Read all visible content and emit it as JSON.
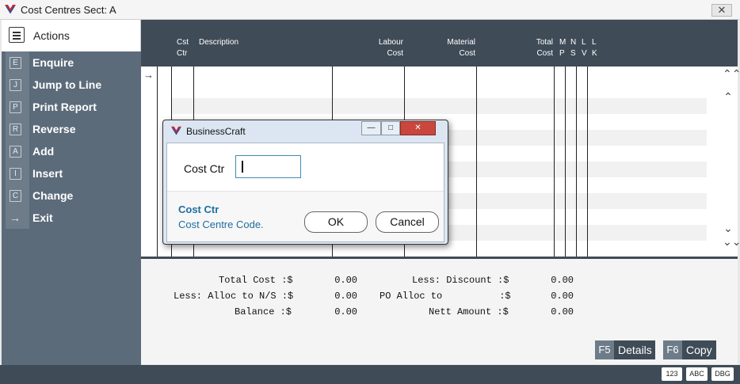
{
  "window": {
    "title": "Cost Centres  Sect: A",
    "close_label": "✕",
    "logo_icon": "businesscraft-logo-icon"
  },
  "sidebar": {
    "header_label": "Actions",
    "items": [
      {
        "key": "E",
        "label": "Enquire"
      },
      {
        "key": "J",
        "label": "Jump to Line"
      },
      {
        "key": "P",
        "label": "Print Report"
      },
      {
        "key": "R",
        "label": "Reverse"
      },
      {
        "key": "A",
        "label": "Add"
      },
      {
        "key": "I",
        "label": "Insert"
      },
      {
        "key": "C",
        "label": "Change"
      },
      {
        "key": "→",
        "label": "Exit"
      }
    ]
  },
  "grid": {
    "columns": [
      {
        "line1": "Cst",
        "line2": "Ctr"
      },
      {
        "line1": "Description",
        "line2": ""
      },
      {
        "line1": "Labour",
        "line2": "Cost"
      },
      {
        "line1": "Material",
        "line2": "Cost"
      },
      {
        "line1": "Total",
        "line2": "Cost"
      },
      {
        "line1": "M",
        "line2": "P"
      },
      {
        "line1": "N",
        "line2": "S"
      },
      {
        "line1": "L",
        "line2": "V"
      },
      {
        "line1": "L",
        "line2": "K"
      }
    ],
    "pointer": "→",
    "scroll": {
      "top": "⌃⌃",
      "up": "⌃",
      "down": "⌄",
      "bottom": "⌄⌄"
    }
  },
  "totals": {
    "total_cost_label": "Total Cost :$",
    "total_cost_value": "0.00",
    "alloc_ns_label": "Less: Alloc to N/S :$",
    "alloc_ns_value": "0.00",
    "balance_label": "Balance :$",
    "balance_value": "0.00",
    "discount_label": "Less: Discount :$",
    "discount_value": "0.00",
    "po_alloc_label": "PO Alloc to          :$",
    "po_alloc_value": "0.00",
    "nett_label": "Nett Amount :$",
    "nett_value": "0.00"
  },
  "fkeys": [
    {
      "key": "F5",
      "label": "Details"
    },
    {
      "key": "F6",
      "label": "Copy"
    }
  ],
  "status_badges": [
    "123",
    "ABC",
    "DBG"
  ],
  "dialog": {
    "title": "BusinessCraft",
    "field_label": "Cost Ctr",
    "field_value": "",
    "hint_title": "Cost Ctr",
    "hint_text": "Cost Centre Code.",
    "ok_label": "OK",
    "cancel_label": "Cancel",
    "minimize_label": "—",
    "maximize_label": "□",
    "close_label": "✕"
  }
}
